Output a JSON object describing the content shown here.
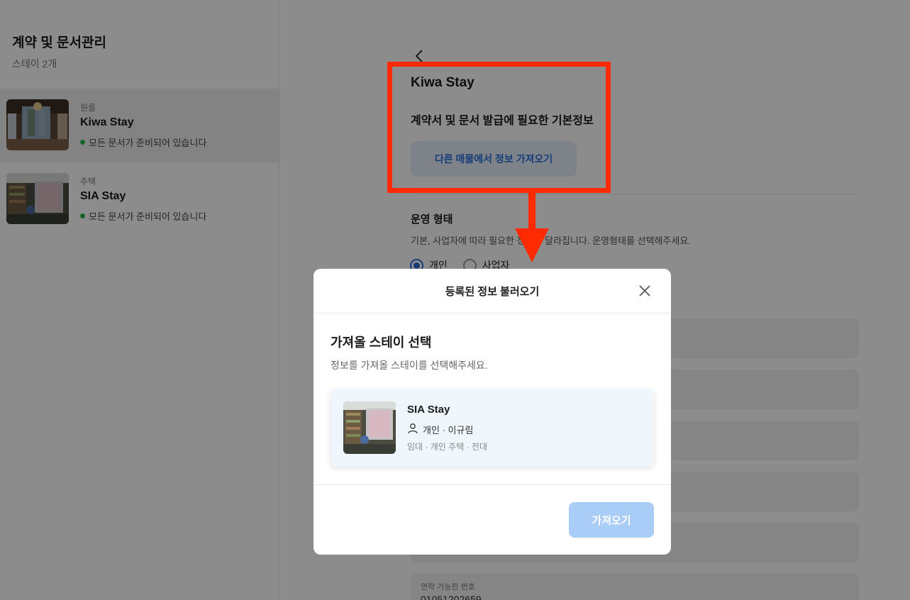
{
  "sidebar": {
    "title": "계약 및 문서관리",
    "subtitle": "스테이 2개",
    "items": [
      {
        "type": "원룸",
        "name": "Kiwa Stay",
        "status": "모든 문서가 준비되어 있습니다",
        "active": true
      },
      {
        "type": "주택",
        "name": "SIA Stay",
        "status": "모든 문서가 준비되어 있습니다",
        "active": false
      }
    ]
  },
  "main": {
    "title": "Kiwa Stay",
    "subtitle": "계약서 및 문서 발급에 필요한 기본정보",
    "import_button": "다른 매물에서 정보 가져오기",
    "section_title": "운영 형태",
    "section_desc": "기본, 사업자에 따라 필요한 정보가 달라집니다. 운영형태를 선택해주세요.",
    "radio_options": [
      "개인",
      "사업자"
    ],
    "selected_option": "개인",
    "fields": [
      {
        "label": "",
        "value": ""
      },
      {
        "label": "",
        "value": ""
      },
      {
        "label": "",
        "value": ""
      },
      {
        "label": "",
        "value": ""
      },
      {
        "label": "",
        "value": ""
      },
      {
        "label": "연락 가능한 번호",
        "value": "01051202659"
      }
    ]
  },
  "modal": {
    "title": "등록된 정보 불러오기",
    "heading": "가져올 스테이 선택",
    "description": "정보를 가져올 스테이를 선택해주세요.",
    "card": {
      "name": "SIA Stay",
      "owner": "개인 · 이규림",
      "tags": "임대 · 개인 주택 · 전대"
    },
    "fetch_button": "가져오기"
  },
  "colors": {
    "accent": "#2a6fdb",
    "annotation": "#ff2a00",
    "status_green": "#2bb24c",
    "fetch_button_disabled": "#a9cdf7"
  }
}
